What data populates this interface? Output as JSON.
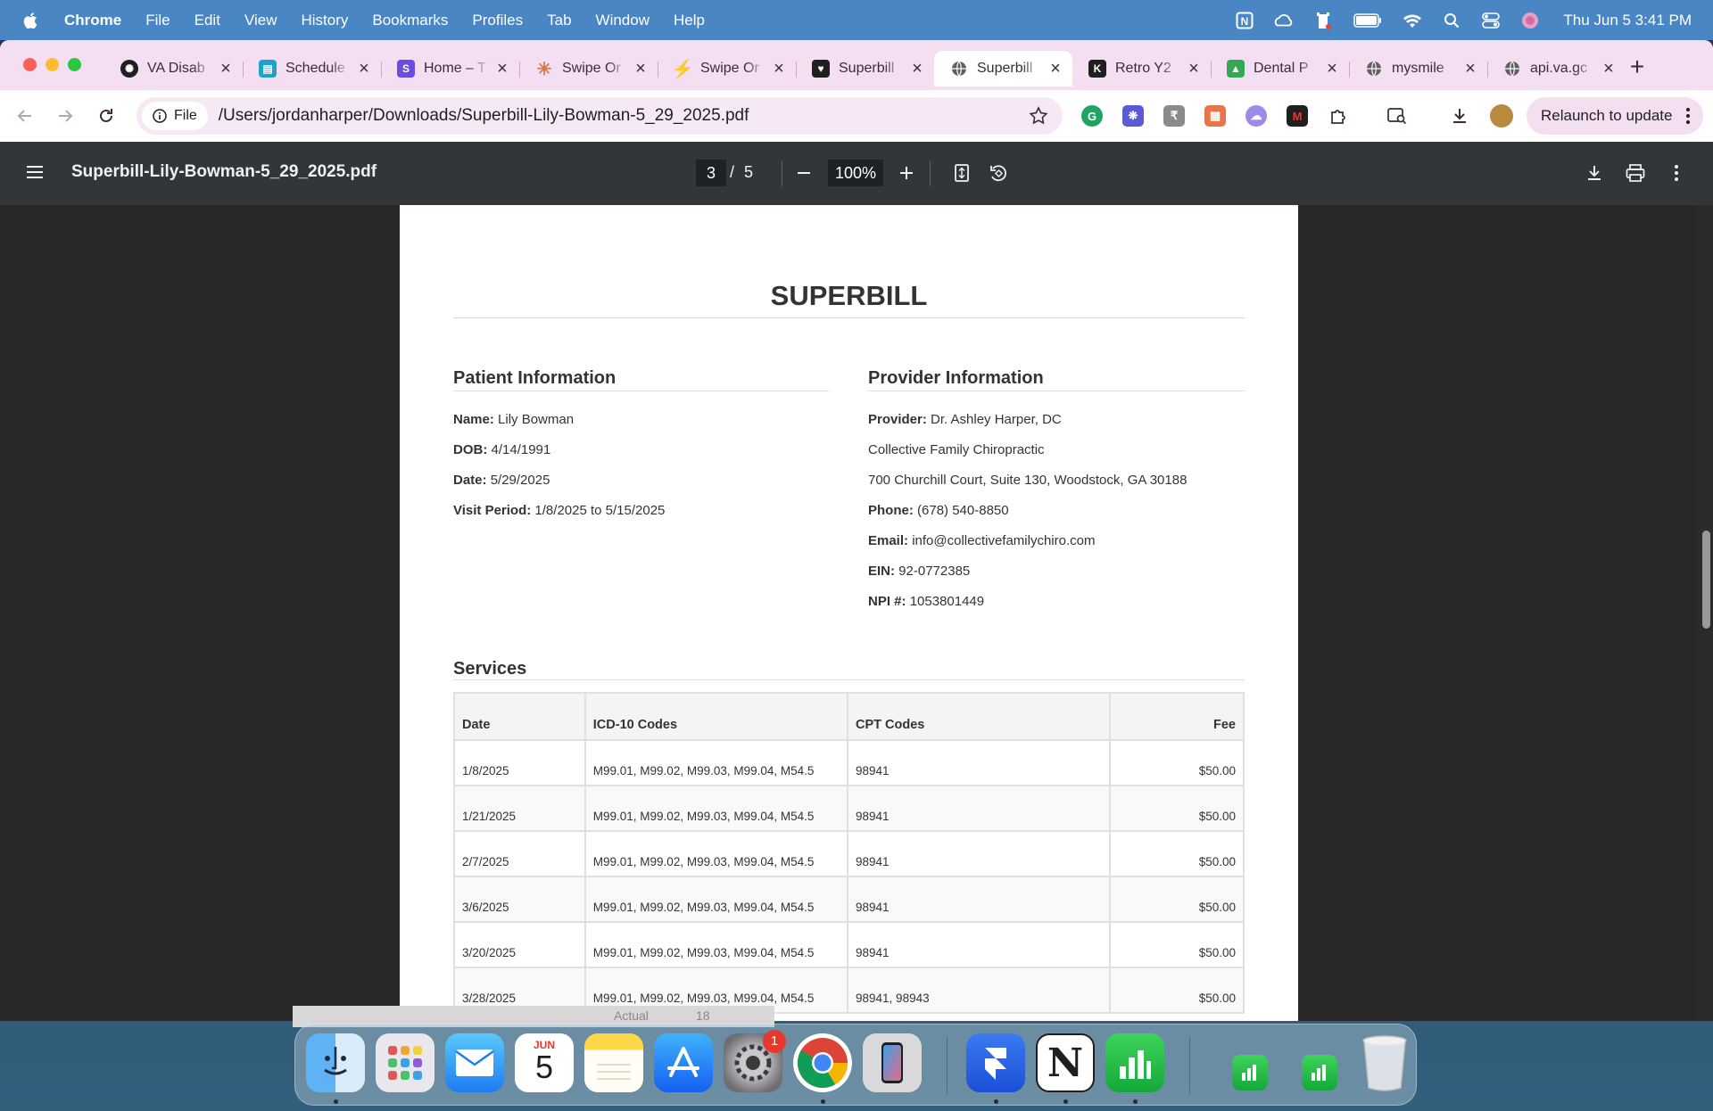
{
  "menubar": {
    "app": "Chrome",
    "items": [
      "File",
      "Edit",
      "View",
      "History",
      "Bookmarks",
      "Profiles",
      "Tab",
      "Window",
      "Help"
    ],
    "clock": "Thu Jun 5  3:41 PM"
  },
  "tabs": [
    {
      "title": "VA Disab",
      "icon": "openai-icon",
      "color": "#1f1f1f"
    },
    {
      "title": "Schedule",
      "icon": "schedule-icon",
      "color": "#1ea3c8"
    },
    {
      "title": "Home – T",
      "icon": "s-logo-icon",
      "color": "#6a4de0"
    },
    {
      "title": "Swipe Or",
      "icon": "claude-icon",
      "color": "#d9774a"
    },
    {
      "title": "Swipe Or",
      "icon": "bolt-icon",
      "color": "#3b6fe0"
    },
    {
      "title": "Superbill",
      "icon": "heart-icon",
      "color": "#1f1f1f"
    },
    {
      "title": "Superbill",
      "icon": "globe-icon",
      "color": "#5f5f5f",
      "active": true
    },
    {
      "title": "Retro Y2",
      "icon": "k-logo-icon",
      "color": "#1f1f1f"
    },
    {
      "title": "Dental P",
      "icon": "triangle-icon",
      "color": "#34a853"
    },
    {
      "title": "mysmile",
      "icon": "globe-icon",
      "color": "#5f5f5f"
    },
    {
      "title": "api.va.gc",
      "icon": "globe-icon",
      "color": "#5f5f5f"
    }
  ],
  "toolbar": {
    "scheme_chip": "File",
    "url": "/Users/jordanharper/Downloads/Superbill-Lily-Bowman-5_29_2025.pdf",
    "relaunch_label": "Relaunch to update"
  },
  "pdf": {
    "filename": "Superbill-Lily-Bowman-5_29_2025.pdf",
    "current_page": "3",
    "page_sep": "/",
    "total_pages": "5",
    "zoom": "100%"
  },
  "doc": {
    "title": "SUPERBILL",
    "patient": {
      "heading": "Patient Information",
      "name_label": "Name:",
      "name": "Lily Bowman",
      "dob_label": "DOB:",
      "dob": "4/14/1991",
      "date_label": "Date:",
      "date": "5/29/2025",
      "period_label": "Visit Period:",
      "period": "1/8/2025 to 5/15/2025"
    },
    "provider": {
      "heading": "Provider Information",
      "provider_label": "Provider:",
      "provider": "Dr. Ashley Harper, DC",
      "practice": "Collective Family Chiropractic",
      "address": "700 Churchill Court, Suite 130, Woodstock, GA 30188",
      "phone_label": "Phone:",
      "phone": "(678) 540-8850",
      "email_label": "Email:",
      "email": "info@collectivefamilychiro.com",
      "ein_label": "EIN:",
      "ein": "92-0772385",
      "npi_label": "NPI #:",
      "npi": "1053801449"
    },
    "services": {
      "heading": "Services",
      "columns": [
        "Date",
        "ICD-10 Codes",
        "CPT Codes",
        "Fee"
      ],
      "rows": [
        [
          "1/8/2025",
          "M99.01, M99.02, M99.03, M99.04, M54.5",
          "98941",
          "$50.00"
        ],
        [
          "1/21/2025",
          "M99.01, M99.02, M99.03, M99.04, M54.5",
          "98941",
          "$50.00"
        ],
        [
          "2/7/2025",
          "M99.01, M99.02, M99.03, M99.04, M54.5",
          "98941",
          "$50.00"
        ],
        [
          "3/6/2025",
          "M99.01, M99.02, M99.03, M99.04, M54.5",
          "98941",
          "$50.00"
        ],
        [
          "3/20/2025",
          "M99.01, M99.02, M99.03, M99.04, M54.5",
          "98941",
          "$50.00"
        ],
        [
          "3/28/2025",
          "M99.01, M99.02, M99.03, M99.04, M54.5",
          "98941, 98943",
          "$50.00"
        ]
      ]
    }
  },
  "background_strip": {
    "left_text": "Actual",
    "right_text": "18"
  },
  "dock": {
    "calendar_month": "JUN",
    "calendar_day": "5",
    "settings_badge": "1"
  },
  "colors": {
    "menubar": "#4a86c4",
    "tabstrip": "#f3dff1",
    "pdf_toolbar": "#323639",
    "pdf_background": "#282828"
  }
}
